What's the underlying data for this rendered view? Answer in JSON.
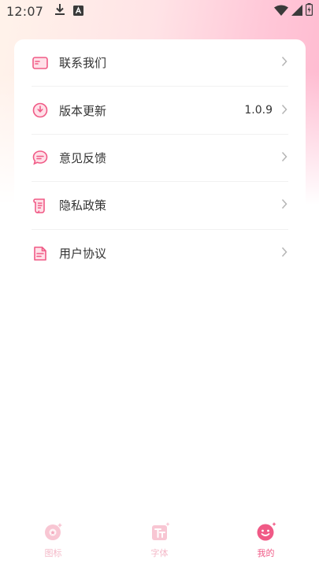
{
  "status_bar": {
    "time": "12:07",
    "icons": [
      "download-icon",
      "a-notification-icon",
      "wifi-icon",
      "signal-icon",
      "battery-icon"
    ]
  },
  "settings": {
    "items": [
      {
        "label": "联系我们",
        "value": "",
        "icon": "mail-icon"
      },
      {
        "label": "版本更新",
        "value": "1.0.9",
        "icon": "update-icon"
      },
      {
        "label": "意见反馈",
        "value": "",
        "icon": "feedback-icon"
      },
      {
        "label": "隐私政策",
        "value": "",
        "icon": "privacy-scroll-icon"
      },
      {
        "label": "用户协议",
        "value": "",
        "icon": "agreement-doc-icon"
      }
    ]
  },
  "tabbar": {
    "tabs": [
      {
        "label": "图标",
        "active": false,
        "icon": "icons-tab-icon"
      },
      {
        "label": "字体",
        "active": false,
        "icon": "font-tab-icon"
      },
      {
        "label": "我的",
        "active": true,
        "icon": "profile-smile-icon"
      }
    ]
  },
  "colors": {
    "accent": "#f05a86",
    "accent_light": "#f9a8bf",
    "inactive_tab": "#f4b9c8",
    "text": "#333333"
  }
}
